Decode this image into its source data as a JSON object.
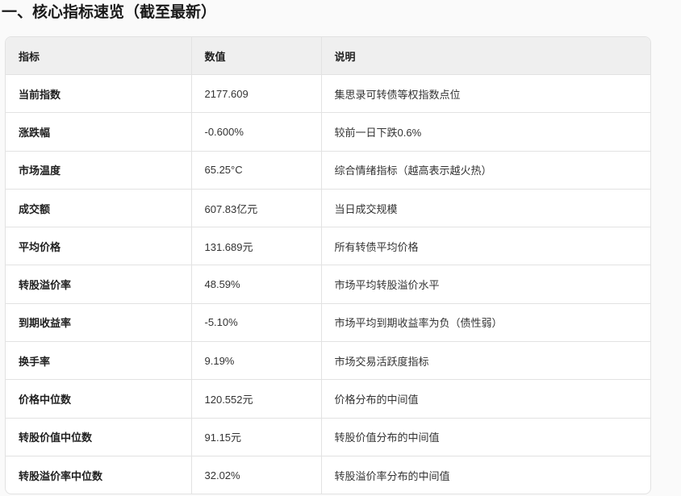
{
  "title": "一、核心指标速览（截至最新）",
  "table": {
    "headers": [
      "指标",
      "数值",
      "说明"
    ],
    "rows": [
      [
        "当前指数",
        "2177.609",
        "集思录可转债等权指数点位"
      ],
      [
        "涨跌幅",
        "-0.600%",
        "较前一日下跌0.6%"
      ],
      [
        "市场温度",
        "65.25°C",
        "综合情绪指标（越高表示越火热）"
      ],
      [
        "成交额",
        "607.83亿元",
        "当日成交规模"
      ],
      [
        "平均价格",
        "131.689元",
        "所有转债平均价格"
      ],
      [
        "转股溢价率",
        "48.59%",
        "市场平均转股溢价水平"
      ],
      [
        "到期收益率",
        "-5.10%",
        "市场平均到期收益率为负（债性弱）"
      ],
      [
        "换手率",
        "9.19%",
        "市场交易活跃度指标"
      ],
      [
        "价格中位数",
        "120.552元",
        "价格分布的中间值"
      ],
      [
        "转股价值中位数",
        "91.15元",
        "转股价值分布的中间值"
      ],
      [
        "转股溢价率中位数",
        "32.02%",
        "转股溢价率分布的中间值"
      ]
    ]
  }
}
